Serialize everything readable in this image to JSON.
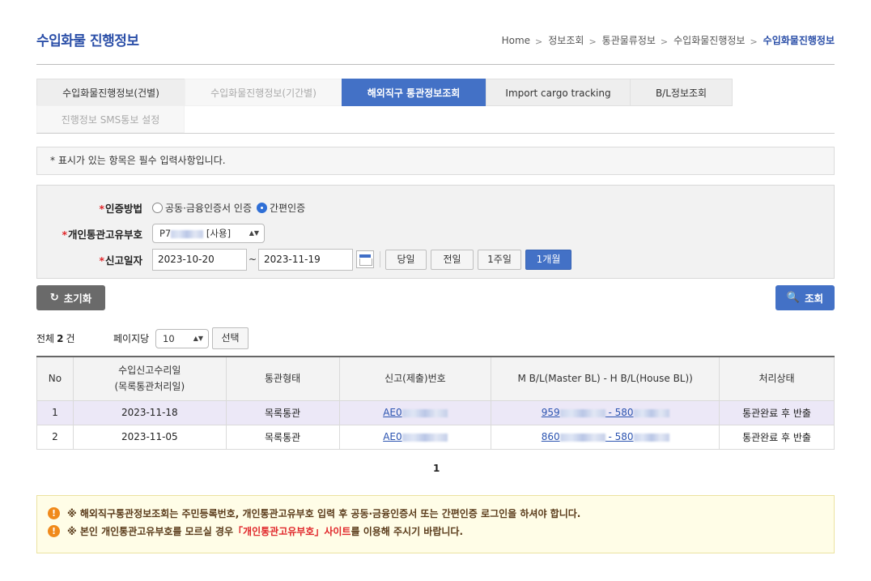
{
  "header": {
    "title": "수입화물 진행정보",
    "breadcrumb": [
      "Home",
      "정보조회",
      "통관물류정보",
      "수입화물진행정보",
      "수입화물진행정보"
    ],
    "accent_color": "#2b4fa8"
  },
  "tabs": [
    {
      "label": "수입화물진행정보(건별)",
      "state": "normal"
    },
    {
      "label": "수입화물진행정보(기간별)",
      "state": "disabled"
    },
    {
      "label": "해외직구 통관정보조회",
      "state": "active"
    },
    {
      "label": "Import cargo tracking",
      "state": "normal"
    },
    {
      "label": "B/L정보조회",
      "state": "normal"
    },
    {
      "label": "진행정보 SMS통보 설정",
      "state": "disabled"
    }
  ],
  "notice": "* 표시가 있는 항목은 필수 입력사항입니다.",
  "form": {
    "auth": {
      "required_mark": "*",
      "label": "인증방법",
      "options": [
        {
          "label": "공동·금융인증서 인증",
          "checked": false
        },
        {
          "label": "간편인증",
          "checked": true
        }
      ]
    },
    "customs_code": {
      "required_mark": "*",
      "label": "개인통관고유부호",
      "value_prefix": "P7",
      "value_suffix": "[사용]",
      "arrow": "▲▼"
    },
    "report_date": {
      "required_mark": "*",
      "label": "신고일자",
      "from": "2023-10-20",
      "tilde": "~",
      "to": "2023-11-19",
      "periods": [
        "당일",
        "전일",
        "1주일",
        "1개월"
      ],
      "active_period": "1개월"
    }
  },
  "buttons": {
    "reset_icon": "↻",
    "reset": "초기화",
    "search_icon": "🔍",
    "search": "조회",
    "select": "선택"
  },
  "summary": {
    "total_prefix": "전체",
    "total_count": "2",
    "total_suffix": "건",
    "per_page_label": "페이지당",
    "per_page_value": "10",
    "per_page_arrow": "▲▼"
  },
  "table": {
    "headers": {
      "no": "No",
      "accept_date_1": "수입신고수리일",
      "accept_date_2": "(목록통관처리일)",
      "clearance_type": "통관형태",
      "report_no": "신고(제출)번호",
      "bl": "M B/L(Master BL) - H B/L(House BL))",
      "status": "처리상태"
    },
    "rows": [
      {
        "no": "1",
        "date": "2023-11-18",
        "type": "목록통관",
        "report_prefix": "AE0",
        "mbl_prefix": "959",
        "bl_mid": " - 580",
        "status": "통관완료 후 반출"
      },
      {
        "no": "2",
        "date": "2023-11-05",
        "type": "목록통관",
        "report_prefix": "AE0",
        "mbl_prefix": "860",
        "bl_mid": " - 580",
        "status": "통관완료 후 반출"
      }
    ]
  },
  "pagination": {
    "current": "1"
  },
  "warnings": {
    "icon": "!",
    "line1": "※ 해외직구통관정보조회는 주민등록번호, 개인통관고유부호 입력 후 공동·금융인증서 또는 간편인증 로그인을 하셔야 합니다.",
    "line2_before": "※ 본인 개인통관고유부호를 모르실 경우 ",
    "line2_link": "「개인통관고유부호」사이트",
    "line2_after": "를 이용해 주시기 바랍니다."
  }
}
